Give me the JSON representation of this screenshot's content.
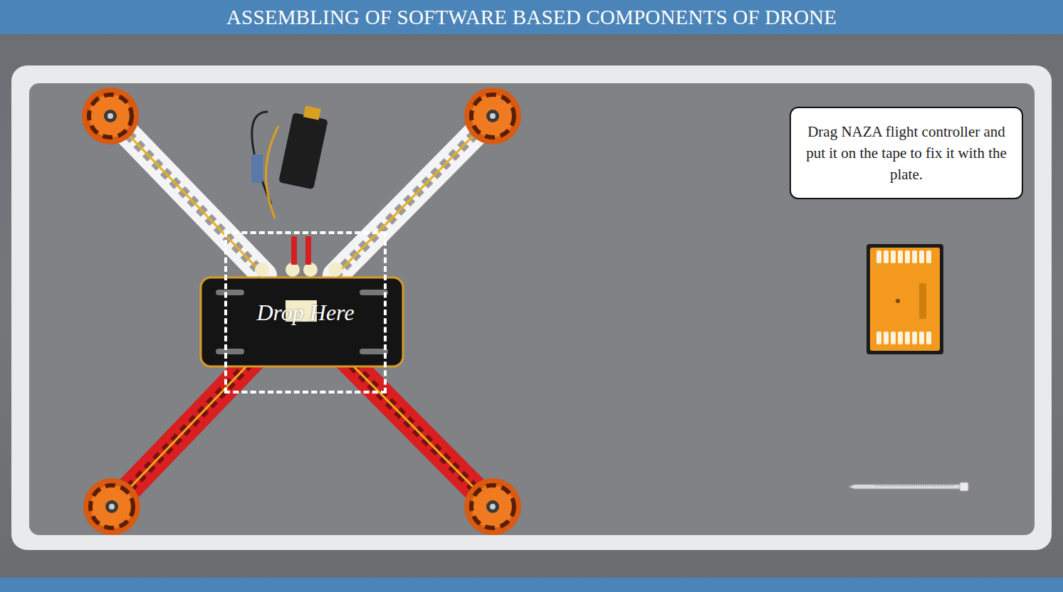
{
  "header": {
    "title": "ASSEMBLING OF SOFTWARE BASED COMPONENTS OF DRONE"
  },
  "instruction": {
    "text": "Drag NAZA flight controller and put it on the tape to fix it with the plate."
  },
  "drop_zone": {
    "label": "Drop Here"
  }
}
